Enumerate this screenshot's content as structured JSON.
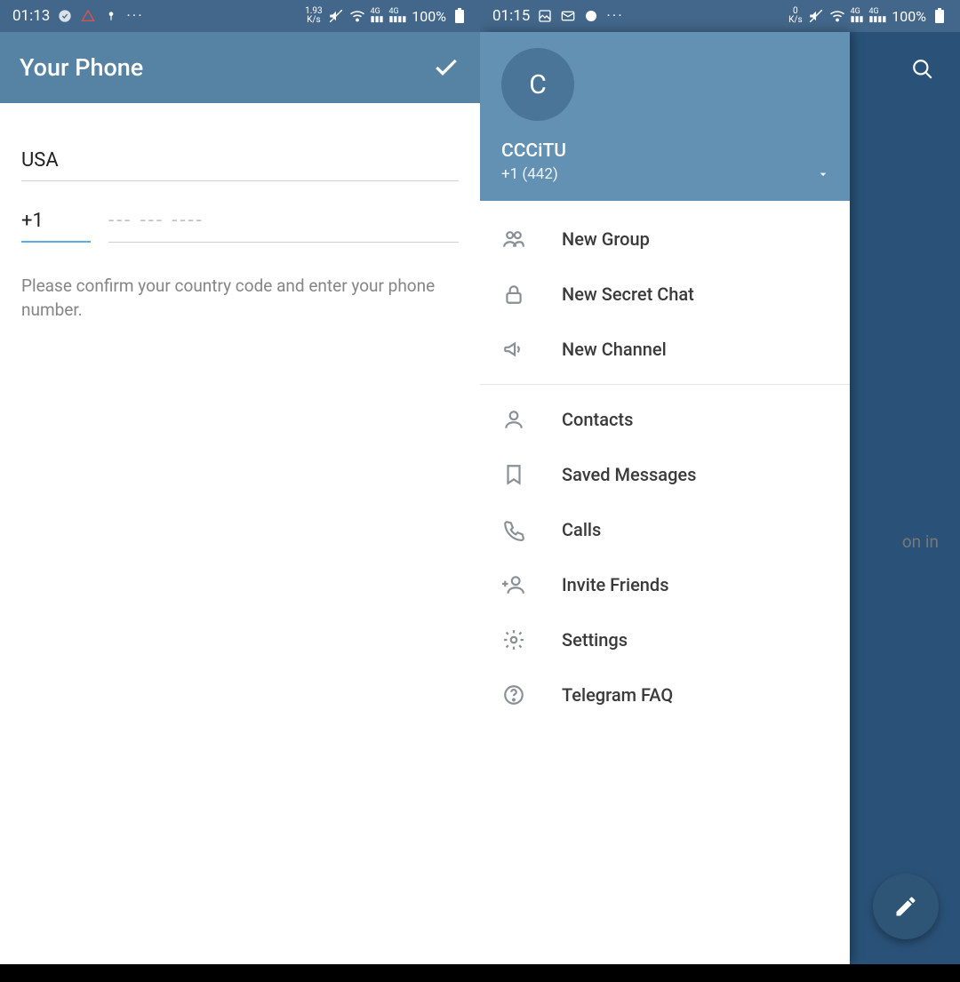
{
  "screen1": {
    "statusbar": {
      "time": "01:13",
      "kbps": "1.93\nK/s",
      "battery": "100%"
    },
    "header": {
      "title": "Your Phone"
    },
    "country": "USA",
    "code": "+1",
    "number_placeholder": "--- --- ----",
    "hint": "Please confirm your country code and enter your phone number."
  },
  "screen2": {
    "statusbar": {
      "time": "01:15",
      "kbps": "0\nK/s",
      "battery": "100%"
    },
    "empty_text": "on in",
    "drawer": {
      "avatar_letter": "C",
      "name": "CCCiTU",
      "phone": "+1 (442)",
      "sections": [
        [
          {
            "icon": "group",
            "label": "New Group"
          },
          {
            "icon": "lock",
            "label": "New Secret Chat"
          },
          {
            "icon": "megaphone",
            "label": "New Channel"
          }
        ],
        [
          {
            "icon": "contact",
            "label": "Contacts"
          },
          {
            "icon": "bookmark",
            "label": "Saved Messages"
          },
          {
            "icon": "call",
            "label": "Calls"
          },
          {
            "icon": "invite",
            "label": "Invite Friends"
          },
          {
            "icon": "settings",
            "label": "Settings"
          },
          {
            "icon": "help",
            "label": "Telegram FAQ"
          }
        ]
      ]
    }
  }
}
